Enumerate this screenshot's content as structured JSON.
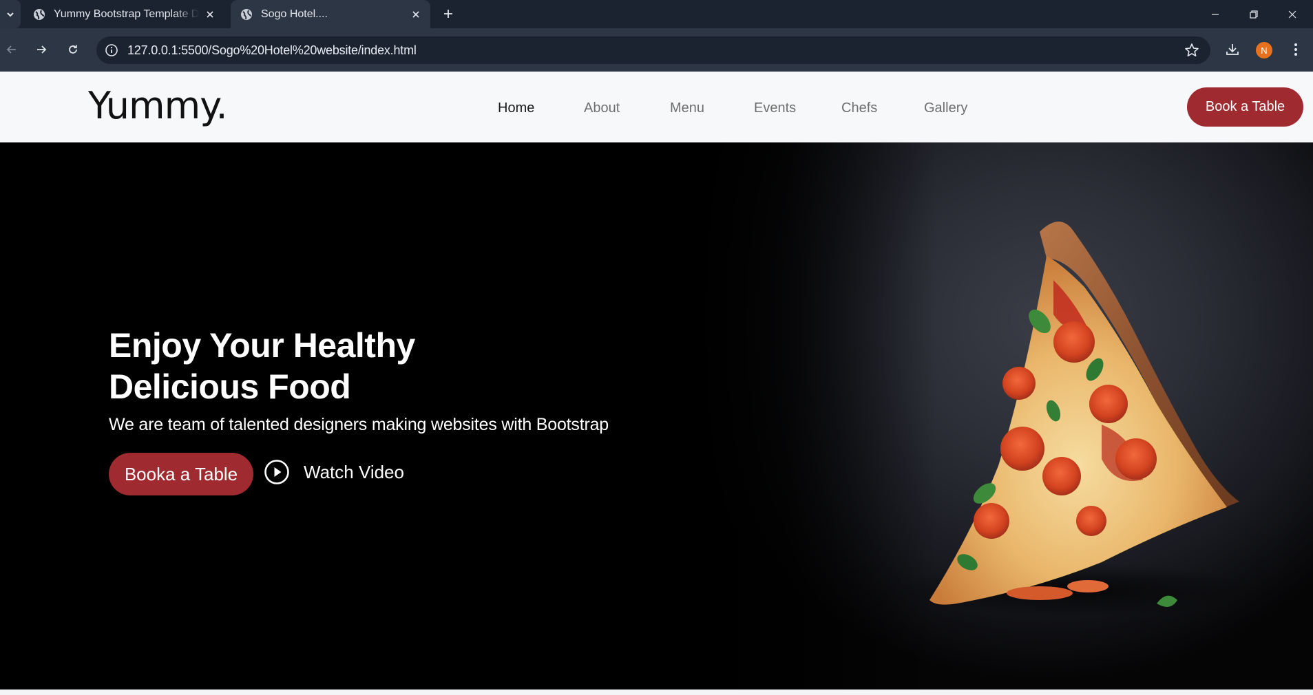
{
  "browser": {
    "tabs": [
      {
        "title": "Yummy Bootstrap Template Demo",
        "active": false
      },
      {
        "title": "Sogo Hotel....",
        "active": true
      }
    ],
    "url": "127.0.0.1:5500/Sogo%20Hotel%20website/index.html",
    "profile_initial": "N",
    "icons": {
      "tab_search": "chevron-down-icon",
      "new_tab": "plus-icon",
      "back": "arrow-left-icon",
      "forward": "arrow-right-icon",
      "reload": "reload-icon",
      "site_info": "info-icon",
      "bookmark": "star-icon",
      "downloads": "download-icon",
      "menu": "kebab-menu-icon"
    }
  },
  "site": {
    "logo": "Yummy.",
    "nav": [
      "Home",
      "About",
      "Menu",
      "Events",
      "Chefs",
      "Gallery"
    ],
    "active_nav": "Home",
    "header_cta": "Book a Table"
  },
  "hero": {
    "title_line1": "Enjoy Your Healthy",
    "title_line2": "Delicious Food",
    "subtitle": "We are team of talented designers making websites with Bootstrap",
    "cta": "Booka a Table",
    "video_link": "Watch Video",
    "image": "pizza-slice"
  },
  "colors": {
    "accent": "#9f2a2f",
    "chrome_dark": "#1b2330",
    "chrome_toolbar": "#2d3644",
    "header_bg": "#f7f8fa",
    "hero_bg": "#000000",
    "avatar": "#e8711e"
  }
}
